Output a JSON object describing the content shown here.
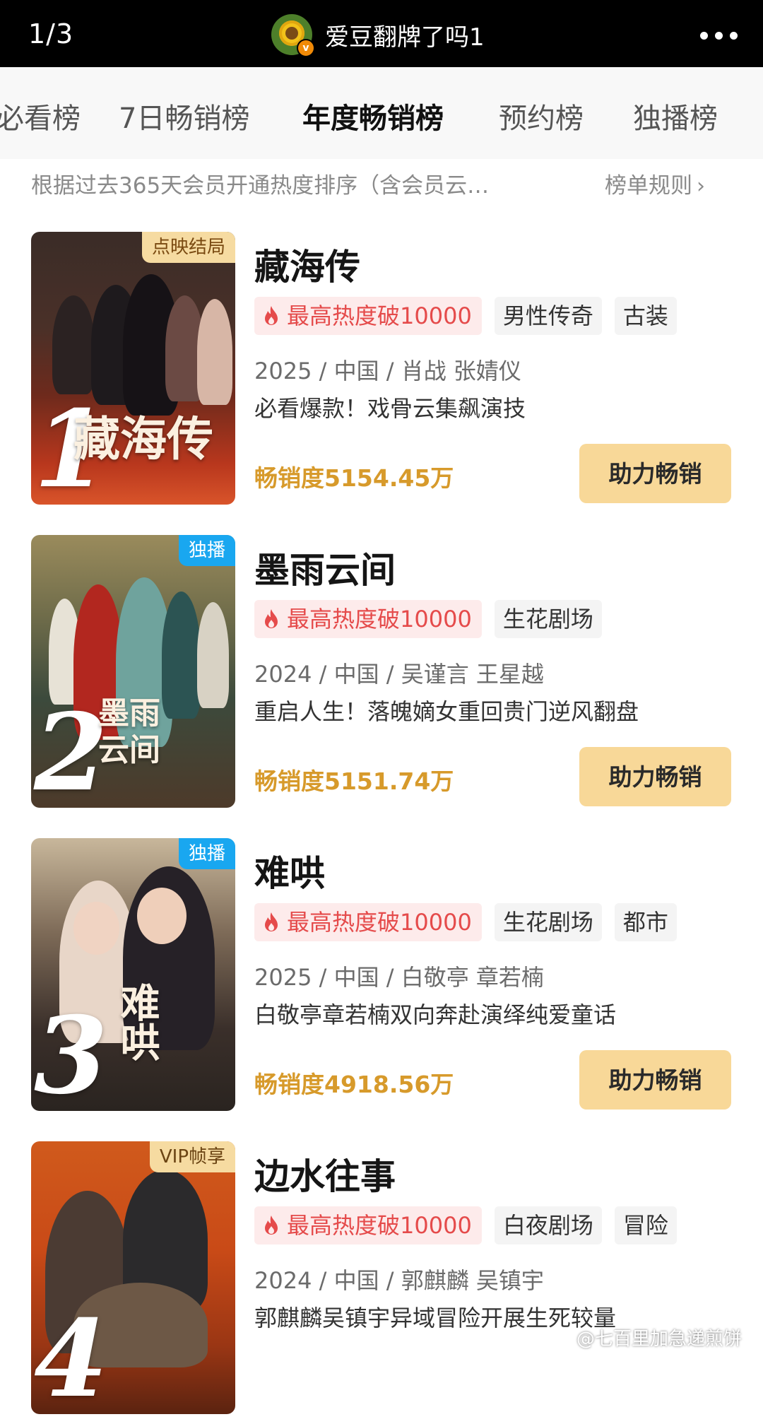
{
  "header": {
    "page_indicator": "1/3",
    "account_name": "爱豆翻牌了吗1",
    "avatar_badge": "v",
    "more_icon": "more-icon"
  },
  "tabs": [
    {
      "label": "必看榜",
      "active": false
    },
    {
      "label": "7日畅销榜",
      "active": false
    },
    {
      "label": "年度畅销榜",
      "active": true
    },
    {
      "label": "预约榜",
      "active": false
    },
    {
      "label": "独播榜",
      "active": false
    }
  ],
  "rule": {
    "description": "根据过去365天会员开通热度排序（含会员云…",
    "link": "榜单规则"
  },
  "items": [
    {
      "rank": "1",
      "corner_tag": "点映结局",
      "poster_title": "藏海传",
      "title": "藏海传",
      "heat": "最高热度破10000",
      "genres": [
        "男性传奇",
        "古装"
      ],
      "meta": "2025 / 中国 / 肖战 张婧仪",
      "slogan": "必看爆款！戏骨云集飙演技",
      "sales": "畅销度5154.45万",
      "button": "助力畅销"
    },
    {
      "rank": "2",
      "corner_tag": "独播",
      "poster_title": "墨雨云间",
      "title": "墨雨云间",
      "heat": "最高热度破10000",
      "genres": [
        "生花剧场"
      ],
      "meta": "2024 / 中国 / 吴谨言 王星越",
      "slogan": "重启人生！落魄嫡女重回贵门逆风翻盘",
      "sales": "畅销度5151.74万",
      "button": "助力畅销"
    },
    {
      "rank": "3",
      "corner_tag": "独播",
      "poster_title": "难哄",
      "title": "难哄",
      "heat": "最高热度破10000",
      "genres": [
        "生花剧场",
        "都市"
      ],
      "meta": "2025 / 中国 / 白敬亭 章若楠",
      "slogan": "白敬亭章若楠双向奔赴演绎纯爱童话",
      "sales": "畅销度4918.56万",
      "button": "助力畅销"
    },
    {
      "rank": "4",
      "corner_tag": "VIP帧享",
      "poster_title": "",
      "title": "边水往事",
      "heat": "最高热度破10000",
      "genres": [
        "白夜剧场",
        "冒险"
      ],
      "meta": "2024 / 中国 / 郭麒麟 吴镇宇",
      "slogan": "郭麒麟吴镇宇异域冒险开展生死较量",
      "sales": "",
      "button": ""
    }
  ],
  "watermark": "@七百里加急递煎饼",
  "colors": {
    "heat_bg": "#fdebeb",
    "heat_text": "#e54b4b",
    "sales_text": "#d79a2b",
    "button_bg": "#f8d898",
    "exclusive_tag": "#19a7f0",
    "ending_tag": "#f6dba1"
  }
}
